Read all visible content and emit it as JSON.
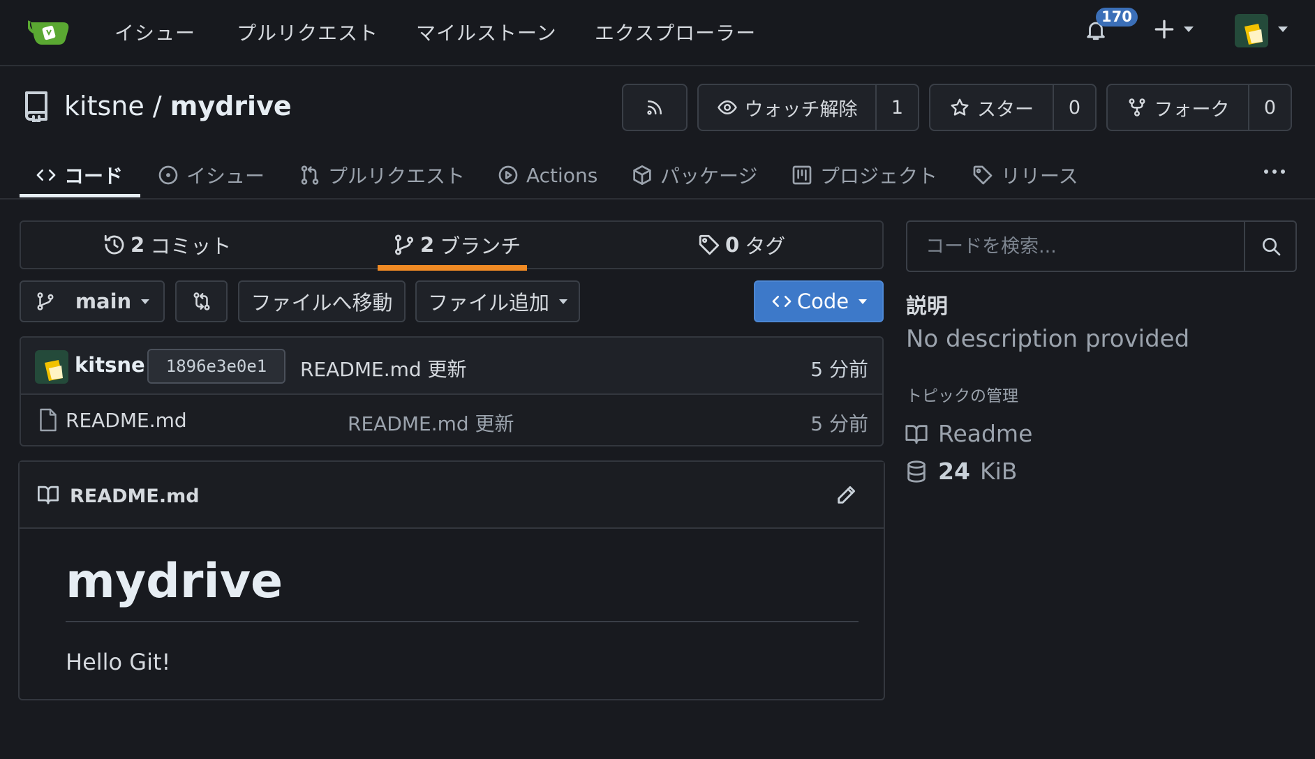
{
  "topnav": {
    "links": [
      "イシュー",
      "プルリクエスト",
      "マイルストーン",
      "エクスプローラー"
    ],
    "notifications_count": "170"
  },
  "repo": {
    "owner": "kitsne",
    "separator": "/",
    "name": "mydrive",
    "watch_label": "ウォッチ解除",
    "watch_count": "1",
    "star_label": "スター",
    "star_count": "0",
    "fork_label": "フォーク",
    "fork_count": "0"
  },
  "tabs": [
    {
      "label": "コード",
      "icon": "code-icon",
      "active": true
    },
    {
      "label": "イシュー",
      "icon": "issue-icon"
    },
    {
      "label": "プルリクエスト",
      "icon": "pull-request-icon"
    },
    {
      "label": "Actions",
      "icon": "play-icon"
    },
    {
      "label": "パッケージ",
      "icon": "package-icon"
    },
    {
      "label": "プロジェクト",
      "icon": "project-icon"
    },
    {
      "label": "リリース",
      "icon": "tag-icon"
    }
  ],
  "stats": {
    "commits_count": "2",
    "commits_label": "コミット",
    "branches_count": "2",
    "branches_label": "ブランチ",
    "tags_count": "0",
    "tags_label": "タグ"
  },
  "toolbar": {
    "branch": "main",
    "goto_file": "ファイルへ移動",
    "add_file": "ファイル追加",
    "code_button": "Code"
  },
  "latest_commit": {
    "author": "kitsne",
    "sha": "1896e3e0e1",
    "message": "README.md 更新",
    "time": "5 分前"
  },
  "files": [
    {
      "name": "README.md",
      "message": "README.md 更新",
      "time": "5 分前"
    }
  ],
  "readme": {
    "filename": "README.md",
    "heading": "mydrive",
    "paragraph": "Hello Git!"
  },
  "sidebar": {
    "search_placeholder": "コードを検索...",
    "about_title": "説明",
    "description": "No description provided",
    "topics_link": "トピックの管理",
    "readme_link": "Readme",
    "size_value": "24",
    "size_unit": "KiB"
  },
  "colors": {
    "accent_blue": "#3d79c9",
    "active_underline": "#f08a24",
    "badge": "#3b6fb8",
    "logo_green": "#5aa832"
  }
}
